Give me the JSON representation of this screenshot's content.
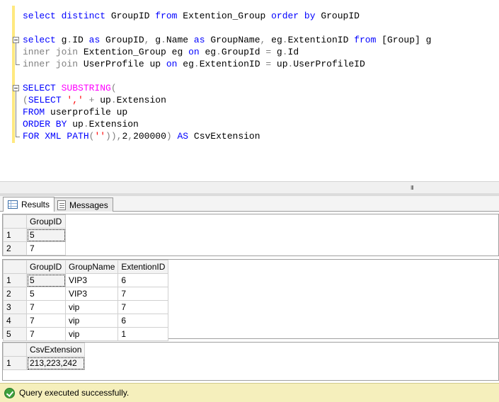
{
  "editor": {
    "lines": [
      [
        {
          "t": "select distinct ",
          "c": "kw"
        },
        {
          "t": "GroupID ",
          "c": ""
        },
        {
          "t": "from ",
          "c": "kw"
        },
        {
          "t": "Extention_Group ",
          "c": ""
        },
        {
          "t": "order by ",
          "c": "kw"
        },
        {
          "t": "GroupID",
          "c": ""
        }
      ],
      [],
      [
        {
          "t": "select ",
          "c": "kw"
        },
        {
          "t": "g",
          "c": ""
        },
        {
          "t": ".",
          "c": "gray"
        },
        {
          "t": "ID ",
          "c": ""
        },
        {
          "t": "as ",
          "c": "kw"
        },
        {
          "t": "GroupID",
          "c": ""
        },
        {
          "t": ", ",
          "c": "gray"
        },
        {
          "t": "g",
          "c": ""
        },
        {
          "t": ".",
          "c": "gray"
        },
        {
          "t": "Name ",
          "c": ""
        },
        {
          "t": "as ",
          "c": "kw"
        },
        {
          "t": "GroupName",
          "c": ""
        },
        {
          "t": ", ",
          "c": "gray"
        },
        {
          "t": "eg",
          "c": ""
        },
        {
          "t": ".",
          "c": "gray"
        },
        {
          "t": "ExtentionID ",
          "c": ""
        },
        {
          "t": "from ",
          "c": "kw"
        },
        {
          "t": "[Group] g",
          "c": ""
        }
      ],
      [
        {
          "t": "inner join ",
          "c": "gray"
        },
        {
          "t": "Extention_Group eg ",
          "c": ""
        },
        {
          "t": "on ",
          "c": "kw"
        },
        {
          "t": "eg",
          "c": ""
        },
        {
          "t": ".",
          "c": "gray"
        },
        {
          "t": "GroupId ",
          "c": ""
        },
        {
          "t": "= ",
          "c": "gray"
        },
        {
          "t": "g",
          "c": ""
        },
        {
          "t": ".",
          "c": "gray"
        },
        {
          "t": "Id",
          "c": ""
        }
      ],
      [
        {
          "t": "inner join ",
          "c": "gray"
        },
        {
          "t": "UserProfile up ",
          "c": ""
        },
        {
          "t": "on ",
          "c": "kw"
        },
        {
          "t": "eg",
          "c": ""
        },
        {
          "t": ".",
          "c": "gray"
        },
        {
          "t": "ExtentionID ",
          "c": ""
        },
        {
          "t": "= ",
          "c": "gray"
        },
        {
          "t": "up",
          "c": ""
        },
        {
          "t": ".",
          "c": "gray"
        },
        {
          "t": "UserProfileID",
          "c": ""
        }
      ],
      [],
      [
        {
          "t": "SELECT ",
          "c": "kw"
        },
        {
          "t": "SUBSTRING",
          "c": "fn"
        },
        {
          "t": "(",
          "c": "gray"
        }
      ],
      [
        {
          "t": "(",
          "c": "gray"
        },
        {
          "t": "SELECT ",
          "c": "kw"
        },
        {
          "t": "','",
          "c": "str"
        },
        {
          "t": " + ",
          "c": "gray"
        },
        {
          "t": "up",
          "c": ""
        },
        {
          "t": ".",
          "c": "gray"
        },
        {
          "t": "Extension",
          "c": ""
        }
      ],
      [
        {
          "t": "FROM ",
          "c": "kw"
        },
        {
          "t": "userprofile up",
          "c": ""
        }
      ],
      [
        {
          "t": "ORDER BY ",
          "c": "kw"
        },
        {
          "t": "up",
          "c": ""
        },
        {
          "t": ".",
          "c": "gray"
        },
        {
          "t": "Extension",
          "c": ""
        }
      ],
      [
        {
          "t": "FOR XML PATH",
          "c": "kw"
        },
        {
          "t": "(",
          "c": "gray"
        },
        {
          "t": "''",
          "c": "str"
        },
        {
          "t": ")),",
          "c": "gray"
        },
        {
          "t": "2",
          "c": ""
        },
        {
          "t": ",",
          "c": "gray"
        },
        {
          "t": "200000",
          "c": ""
        },
        {
          "t": ") ",
          "c": "gray"
        },
        {
          "t": "AS ",
          "c": "kw"
        },
        {
          "t": "CsvExtension",
          "c": ""
        }
      ]
    ]
  },
  "scrollbar": {
    "grip": "III"
  },
  "tabs": {
    "results_label": "Results",
    "messages_label": "Messages"
  },
  "results": {
    "set1": {
      "columns": [
        "GroupID"
      ],
      "rows": [
        [
          "1",
          "5"
        ],
        [
          "2",
          "7"
        ]
      ]
    },
    "set2": {
      "columns": [
        "GroupID",
        "GroupName",
        "ExtentionID"
      ],
      "rows": [
        [
          "1",
          "5",
          "VIP3",
          "6"
        ],
        [
          "2",
          "5",
          "VIP3",
          "7"
        ],
        [
          "3",
          "7",
          "vip",
          "7"
        ],
        [
          "4",
          "7",
          "vip",
          "6"
        ],
        [
          "5",
          "7",
          "vip",
          "1"
        ]
      ]
    },
    "set3": {
      "columns": [
        "CsvExtension"
      ],
      "rows": [
        [
          "1",
          "213,223,242"
        ]
      ]
    }
  },
  "status": {
    "message": "Query executed successfully."
  },
  "colors": {
    "keyword": "#0000ff",
    "operator": "#808080",
    "function": "#ff00ff",
    "string": "#ff0000",
    "status_bg": "#f5efbc"
  }
}
